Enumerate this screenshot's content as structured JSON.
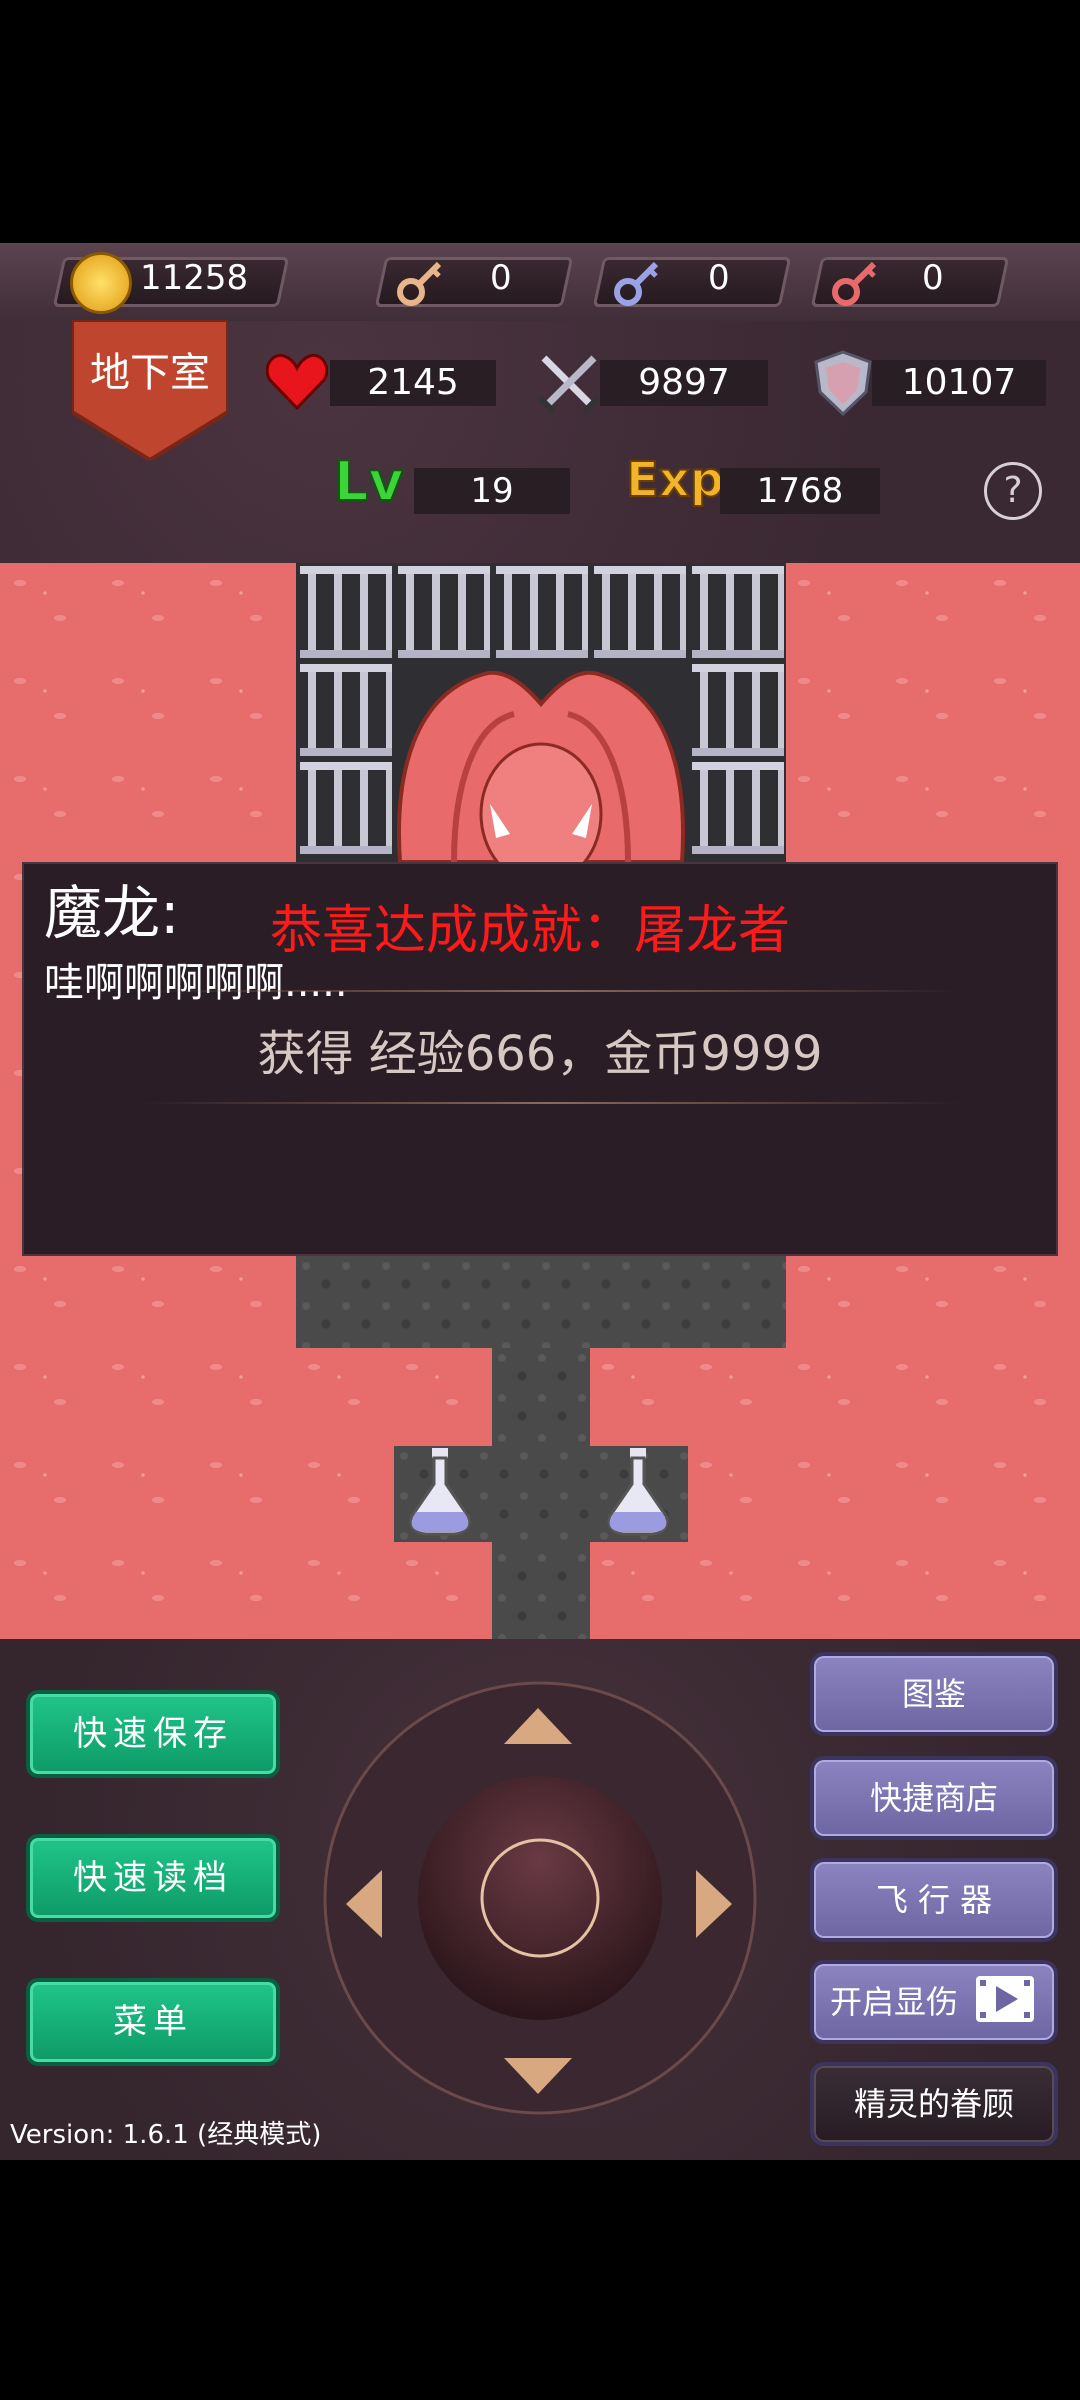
{
  "resources": {
    "gold": "11258",
    "yellow_keys": "0",
    "blue_keys": "0",
    "red_keys": "0"
  },
  "location": "地下室",
  "stats": {
    "hp": "2145",
    "attack": "9897",
    "defense": "10107",
    "level_label": "Lv",
    "level": "19",
    "exp_label": "Exp",
    "exp": "1768"
  },
  "help_label": "?",
  "dialog": {
    "speaker": "魔龙:",
    "message": "哇啊啊啊啊啊.....",
    "achievement": "恭喜达成成就：屠龙者",
    "reward": "获得 经验666，金币9999"
  },
  "buttons": {
    "quick_save": "快速保存",
    "quick_load": "快速读档",
    "menu": "菜单",
    "encyclopedia": "图鉴",
    "shop": "快捷商店",
    "fly": "飞 行 器",
    "damage_display": "开启显伤",
    "fairy": "精灵的眷顾"
  },
  "version": "Version: 1.6.1 (经典模式)",
  "colors": {
    "achievement": "#ff1a1a",
    "green_button": "#12b07a",
    "purple_button": "#7d77b5",
    "lava": "#e76d6d"
  }
}
